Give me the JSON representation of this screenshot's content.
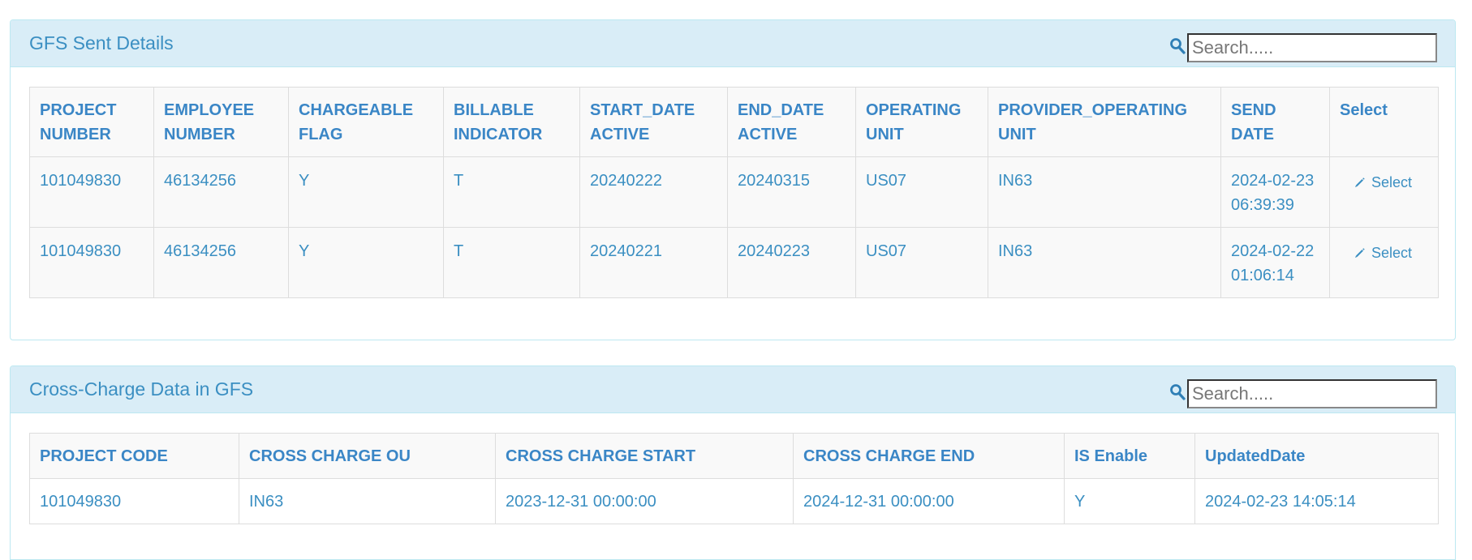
{
  "colors": {
    "panel_heading_bg": "#d9edf7",
    "panel_border": "#bce8f1",
    "text_blue": "#3b8fc2",
    "striped_row_bg": "#f9f9f9"
  },
  "gfs_panel": {
    "title": "GFS Sent Details",
    "search_placeholder": "Search.....",
    "search_icon": "search-icon",
    "columns": [
      [
        "PROJECT",
        "NUMBER"
      ],
      [
        "EMPLOYEE",
        "NUMBER"
      ],
      [
        "CHARGEABLE",
        "FLAG"
      ],
      [
        "BILLABLE",
        "INDICATOR"
      ],
      [
        "START_DATE",
        "ACTIVE"
      ],
      [
        "END_DATE",
        "ACTIVE"
      ],
      [
        "OPERATING",
        "UNIT"
      ],
      [
        "PROVIDER_OPERATING",
        "UNIT"
      ],
      [
        "SEND",
        "DATE"
      ],
      [
        "Select",
        ""
      ]
    ],
    "rows": [
      {
        "project_number": "101049830",
        "employee_number": "46134256",
        "chargeable_flag": "Y",
        "billable_indicator": "T",
        "start_date_active": "20240222",
        "end_date_active": "20240315",
        "operating_unit": "US07",
        "provider_operating_unit": "IN63",
        "send_date_line1": "2024-02-23",
        "send_date_line2": "06:39:39",
        "select_label": "Select",
        "select_icon": "pencil-icon"
      },
      {
        "project_number": "101049830",
        "employee_number": "46134256",
        "chargeable_flag": "Y",
        "billable_indicator": "T",
        "start_date_active": "20240221",
        "end_date_active": "20240223",
        "operating_unit": "US07",
        "provider_operating_unit": "IN63",
        "send_date_line1": "2024-02-22",
        "send_date_line2": "01:06:14",
        "select_label": "Select",
        "select_icon": "pencil-icon"
      }
    ]
  },
  "cc_panel": {
    "title": "Cross-Charge Data in GFS",
    "search_placeholder": "Search.....",
    "search_icon": "search-icon",
    "columns": [
      "PROJECT CODE",
      "CROSS CHARGE OU",
      "CROSS CHARGE START",
      "CROSS CHARGE END",
      "IS Enable",
      "UpdatedDate"
    ],
    "rows": [
      {
        "project_code": "101049830",
        "cross_charge_ou": "IN63",
        "cross_charge_start": "2023-12-31 00:00:00",
        "cross_charge_end": "2024-12-31 00:00:00",
        "is_enable": "Y",
        "updated_date": "2024-02-23 14:05:14"
      }
    ]
  }
}
